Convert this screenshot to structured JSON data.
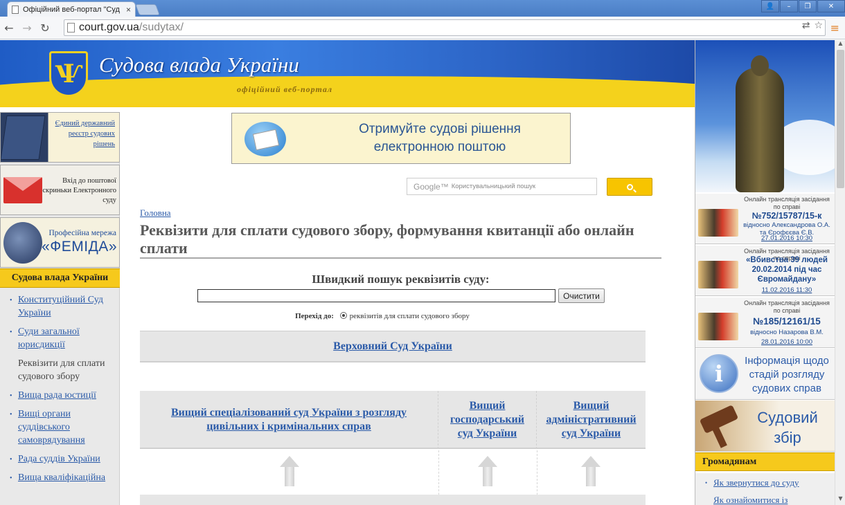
{
  "browser": {
    "tab_title": "Офіційний веб-портал \"Суд",
    "tab_close": "×",
    "url_host": "court.gov.ua",
    "url_path": "/sudytax/",
    "back": "←",
    "forward": "→",
    "reload": "↻",
    "translate_glyph": "⇄",
    "star_glyph": "☆",
    "menu_glyph": "≡",
    "win_user": "👤",
    "win_min": "–",
    "win_max": "❐",
    "win_close": "✕"
  },
  "header": {
    "emblem_glyph": "Ѱ",
    "title": "Судова влада України",
    "subtitle": "офіційний веб-портал"
  },
  "left": {
    "registry": "Єдиний державний реєстр судових рішень",
    "mail": "Вхід до поштової скриньки Електронного суду",
    "femida_line1": "Професійна мережа",
    "femida_line2": "«ФЕМІДА»",
    "section_title": "Судова влада України",
    "nav": [
      {
        "label": "Конституційний Суд України",
        "link": true
      },
      {
        "label": "Суди загальної юрисдикції",
        "link": true
      },
      {
        "label": "Реквізити для сплати судового збору",
        "link": false
      },
      {
        "label": "Вища рада юстиції",
        "link": true
      },
      {
        "label": "Вищі органи суддівського самоврядування",
        "link": true
      },
      {
        "label": "Рада суддів України",
        "link": true
      },
      {
        "label": "Вища кваліфікаційна",
        "link": true
      }
    ]
  },
  "promo": {
    "text": "Отримуйте судові рішення електронною поштою"
  },
  "search": {
    "google_label": "Google™",
    "placeholder": "Користувальницький пошук"
  },
  "main": {
    "breadcrumb": "Головна",
    "title": "Реквізити для сплати судового збору, формування квитанції або онлайн сплати",
    "quick_search_label": "Швидкий пошук реквізитів суду:",
    "clear_button": "Очистити",
    "goto_label": "Перехід до:",
    "goto_option": "реквізитів для сплати судового збору",
    "supreme_court": "Верховний Суд України",
    "courts": [
      "Вищий спеціалізований суд України з розгляду цивільних і кримінальних справ",
      "Вищий господарський суд України",
      "Вищий адміністративний суд України"
    ]
  },
  "right": {
    "streams": [
      {
        "heading": "Онлайн трансляція засідання по справі",
        "case": "№752/15787/15-к",
        "detail": "відносно Александрова О.А. та Єрофєєва Є.В.",
        "datetime": "27.01.2016 10:30"
      },
      {
        "heading": "Онлайн трансляція засідання по справі",
        "case": "«Вбивства 39 людей 20.02.2014 під час Євромайдану»",
        "detail": "",
        "datetime": "11.02.2016 11:30"
      },
      {
        "heading": "Онлайн трансляція засідання по справі",
        "case": "№185/12161/15",
        "detail": "відносно Назарова В.М.",
        "datetime": "28.01.2016 10:00"
      }
    ],
    "info_glyph": "i",
    "info_text": "Інформація щодо стадій розгляду судових справ",
    "fee_text": "Судовий збір",
    "citizens_title": "Громадянам",
    "citizens": [
      "Як звернутися до суду",
      "Як ознайомитися із"
    ]
  },
  "colors": {
    "link": "#2a5aa8",
    "accent_yellow": "#f6c91c",
    "banner_blue": "#1f5cc5"
  },
  "icons": {
    "bullet": "•"
  }
}
